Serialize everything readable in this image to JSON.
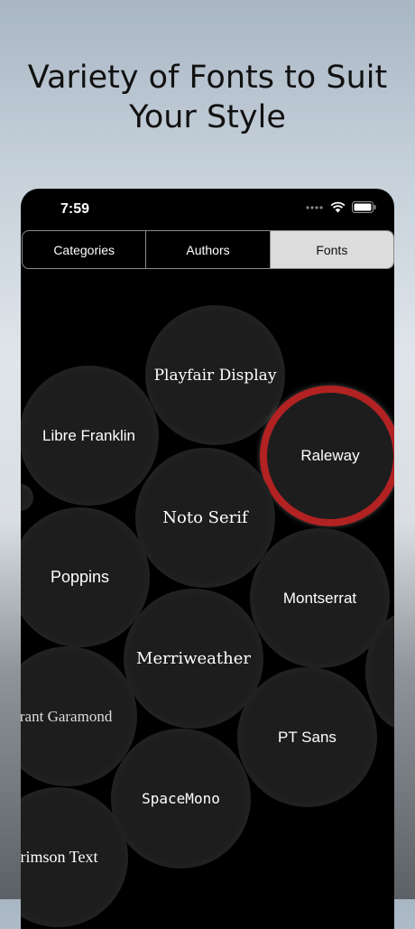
{
  "headline": "Variety of Fonts to Suit\nYour Style",
  "status_bar": {
    "time": "7:59"
  },
  "tabs": [
    {
      "label": "Categories",
      "active": false
    },
    {
      "label": "Authors",
      "active": false
    },
    {
      "label": "Fonts",
      "active": true
    }
  ],
  "fonts": [
    {
      "name": "Playfair Display"
    },
    {
      "name": "Libre Franklin"
    },
    {
      "name": "Raleway",
      "selected": true
    },
    {
      "name": "Noto Serif"
    },
    {
      "name": "Poppins"
    },
    {
      "name": "Montserrat"
    },
    {
      "name": "Merriweather"
    },
    {
      "name": "Cormorant Garamond"
    },
    {
      "name": "PT Sans"
    },
    {
      "name": "SpaceMono"
    },
    {
      "name": "Crimson Text"
    }
  ],
  "colors": {
    "selected_ring": "#b22222",
    "bubble": "#1d1d1d",
    "active_tab": "#dcdcdc"
  },
  "icons": [
    "signal-dots-icon",
    "wifi-icon",
    "battery-icon"
  ]
}
